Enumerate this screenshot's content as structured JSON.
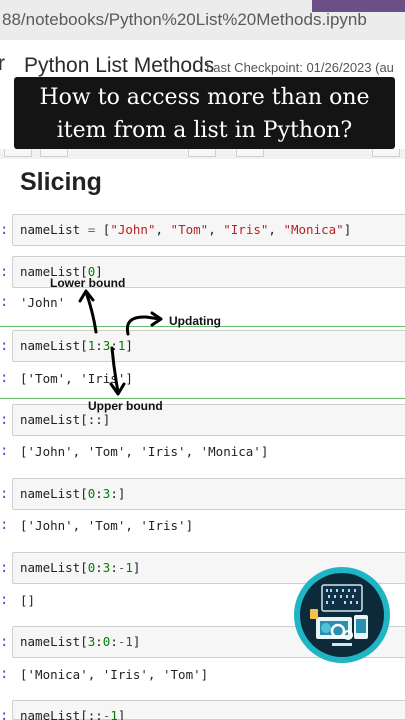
{
  "browser": {
    "url_fragment": "88/notebooks/Python%20List%20Methods.ipynb"
  },
  "notebook": {
    "logo_letter": "r",
    "name": "Python List Methods",
    "checkpoint": "Last Checkpoint: 01/26/2023 (au"
  },
  "overlay": {
    "line1": "How to access more than one",
    "line2": "item from a list in Python?"
  },
  "section": {
    "heading": "Slicing"
  },
  "prompt_char": ":",
  "cells": [
    {
      "code": "nameList = [\"John\", \"Tom\", \"Iris\", \"Monica\"]",
      "output": ""
    },
    {
      "code": "nameList[0]",
      "output": "'John'"
    },
    {
      "code": "nameList[1:3:1]",
      "output": "['Tom', 'Iris']"
    },
    {
      "code": "nameList[::]",
      "output": "['John', 'Tom', 'Iris', 'Monica']"
    },
    {
      "code": "nameList[0:3:]",
      "output": "['John', 'Tom', 'Iris']"
    },
    {
      "code": "nameList[0:3:-1]",
      "output": "[]"
    },
    {
      "code": "nameList[3:0:-1]",
      "output": "['Monica', 'Iris', 'Tom']"
    },
    {
      "code": "nameList[::-1]",
      "output": ""
    }
  ],
  "annotations": {
    "lower": "Lower bound",
    "updating": "Updating",
    "upper": "Upper bound"
  },
  "colors": {
    "browser_frame": "#6b4f86",
    "overlay_bg": "#141414",
    "string_literal": "#ba2121",
    "number_literal": "#008000",
    "prompt": "#3f51b5",
    "active_cell_border": "#66bb6a",
    "logo_ring": "#1fb5c4"
  }
}
